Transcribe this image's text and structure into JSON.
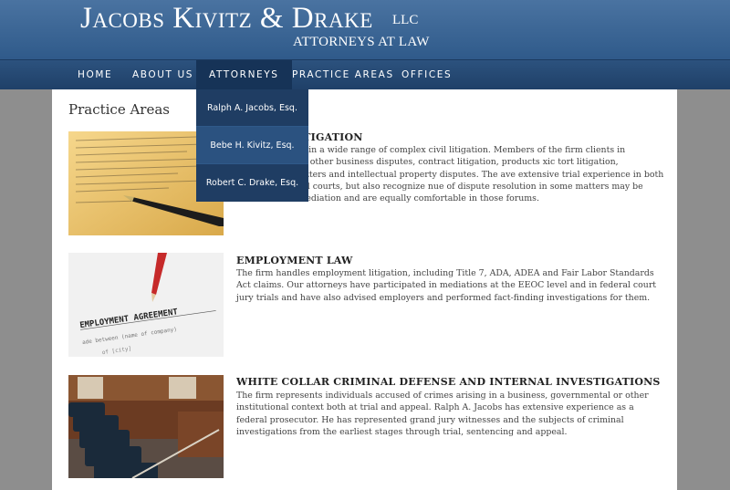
{
  "header": {
    "logo_main": "Jacobs Kivitz & Drake",
    "logo_llc": "LLC",
    "logo_sub": "ATTORNEYS AT LAW"
  },
  "nav": {
    "items": [
      {
        "label": "HOME"
      },
      {
        "label": "ABOUT US"
      },
      {
        "label": "ATTORNEYS"
      },
      {
        "label": "PRACTICE AREAS"
      },
      {
        "label": "OFFICES"
      }
    ],
    "active": "ATTORNEYS"
  },
  "dropdown": {
    "items": [
      {
        "label": "Ralph A. Jacobs, Esq."
      },
      {
        "label": "Bebe H. Kivitz, Esq."
      },
      {
        "label": "Robert C. Drake, Esq."
      }
    ]
  },
  "page": {
    "title": "Practice Areas",
    "sections": [
      {
        "title": "LITIGATION",
        "body": "resented clients in a wide range of complex civil litigation. Members of the firm clients in shareholder and other business disputes, contract litigation, products xic tort litigation, employment matters and intellectual property disputes. The ave extensive trial experience in both state and federal courts, but also recognize nue of dispute resolution in some matters may be arbitration or mediation and are equally comfortable in those forums.",
        "image": "contract-signing-photo"
      },
      {
        "title": "EMPLOYMENT LAW",
        "body": "The firm handles employment litigation, including Title 7, ADA, ADEA and Fair Labor Standards Act claims. Our attorneys have participated in mediations at the EEOC level and in federal court jury trials and have also advised employers and performed fact-finding investigations for them.",
        "image": "employment-agreement-photo",
        "image_text": "EMPLOYMENT AGREEMENT"
      },
      {
        "title": "WHITE COLLAR CRIMINAL DEFENSE AND INTERNAL INVESTIGATIONS",
        "body": "The firm represents individuals accused of crimes arising in a business, governmental or other institutional context both at trial and appeal. Ralph A. Jacobs has extensive experience as a federal prosecutor. He has represented grand jury witnesses and the subjects of criminal investigations from the earliest stages through trial, sentencing and appeal.",
        "image": "courtroom-photo"
      }
    ]
  }
}
